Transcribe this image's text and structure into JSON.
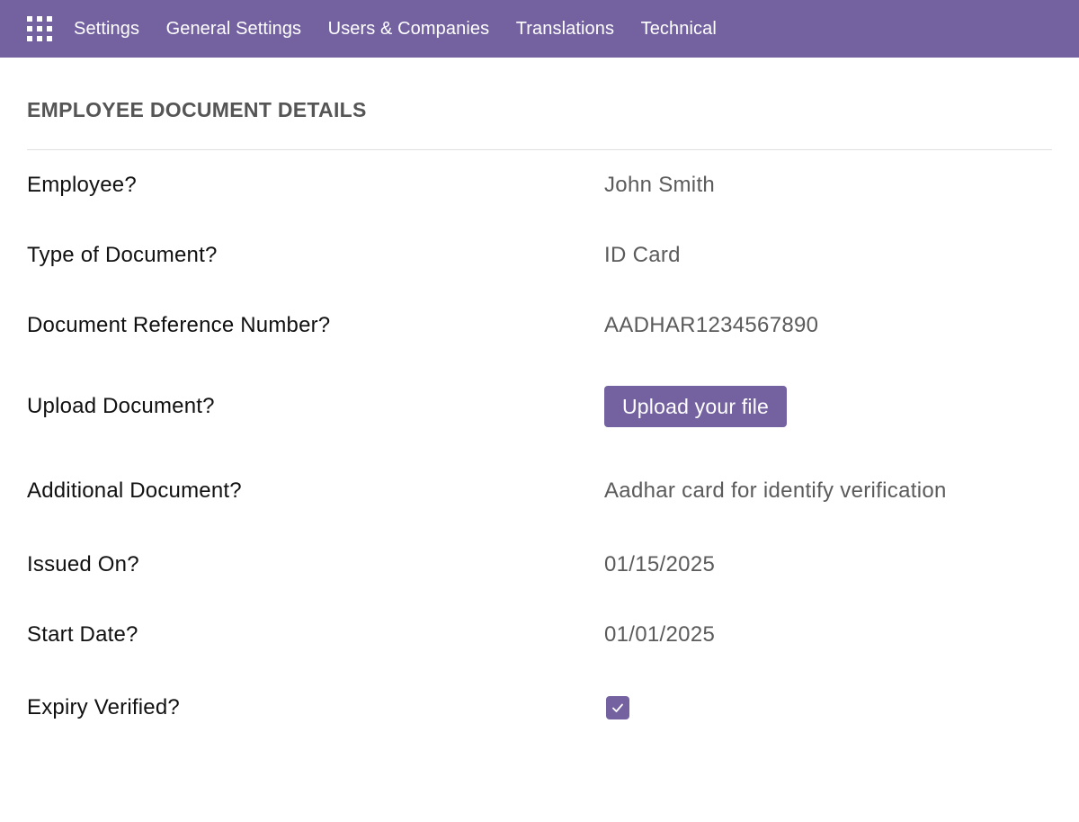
{
  "topbar": {
    "menu": [
      "Settings",
      "General Settings",
      "Users & Companies",
      "Translations",
      "Technical"
    ]
  },
  "section": {
    "title": "EMPLOYEE DOCUMENT DETAILS"
  },
  "fields": {
    "employee": {
      "label": "Employee?",
      "value": "John Smith"
    },
    "doc_type": {
      "label": "Type of Document?",
      "value": "ID Card"
    },
    "ref_number": {
      "label": "Document Reference Number?",
      "value": "AADHAR1234567890"
    },
    "upload": {
      "label": "Upload Document?",
      "button": "Upload your file"
    },
    "additional": {
      "label": "Additional Document?",
      "value": "Aadhar card for identify verification"
    },
    "issued_on": {
      "label": "Issued On?",
      "value": "01/15/2025"
    },
    "start_date": {
      "label": "Start Date?",
      "value": "01/01/2025"
    },
    "expiry_verified": {
      "label": "Expiry Verified?",
      "checked": true
    }
  },
  "colors": {
    "brand": "#7462a0"
  }
}
